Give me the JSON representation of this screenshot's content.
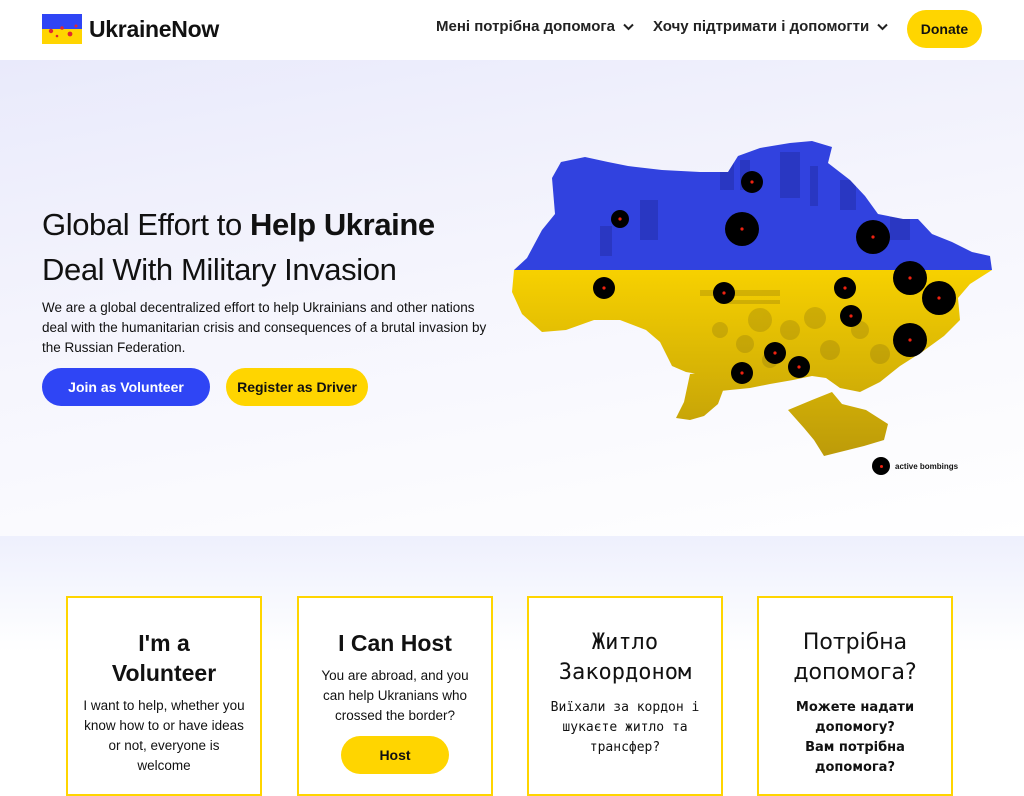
{
  "brand": {
    "name": "UkraineNow",
    "colors": {
      "blue": "#2f45f5",
      "yellow": "#ffd500"
    }
  },
  "nav": {
    "items": [
      {
        "label": "Мені потрібна допомога",
        "icon": "chevron-down-icon"
      },
      {
        "label": "Хочу підтримати і допомогти",
        "icon": "chevron-down-icon"
      }
    ],
    "donate_label": "Donate"
  },
  "hero": {
    "title_line1_plain": "Global Effort to ",
    "title_line1_bold": "Help Ukraine",
    "title_line2": "Deal With Military Invasion",
    "description": "We are a global decentralized effort to help Ukrainians and other nations deal with the humanitarian crisis and consequences of a brutal invasion by the Russian Federation.",
    "volunteer_button": "Join as Volunteer",
    "driver_button": "Register as Driver",
    "map_legend": "active bombings"
  },
  "cards": [
    {
      "title_line1": "I'm a",
      "title_line2": "Volunteer",
      "text": "I want to help, whether you know how to or have ideas or not, everyone is welcome"
    },
    {
      "title": "I Can Host",
      "text": "You are abroad, and you can help Ukranians who crossed the border?",
      "button": "Host"
    },
    {
      "title_line1": "Житло",
      "title_line2": "Закордоном",
      "text": "Виїхали за кордон і шукаєте житло та трансфер?"
    },
    {
      "title_line1": "Потрібна",
      "title_line2": "допомога?",
      "text_line1": "Можете надати допомогу?",
      "text_line2": "Вам потрібна допомога?"
    }
  ]
}
